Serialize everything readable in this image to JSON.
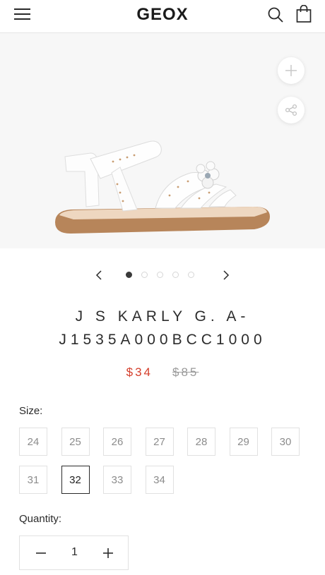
{
  "header": {
    "logo": "GEOX",
    "icons": [
      "hamburger-menu-icon",
      "search-icon",
      "shopping-bag-icon"
    ]
  },
  "gallery": {
    "image_alt": "White children's sandal with flower detail",
    "zoom_icon": "plus-icon",
    "share_icon": "share-icon",
    "slide_count": 5,
    "active_slide": 1
  },
  "product": {
    "title": "J S KARLY G. A-J1535A000BCC1000",
    "price_sale": "$34",
    "price_original": "$85"
  },
  "size": {
    "label": "Size:",
    "options": [
      "24",
      "25",
      "26",
      "27",
      "28",
      "29",
      "30",
      "31",
      "32",
      "33",
      "34"
    ],
    "selected": "32"
  },
  "quantity": {
    "label": "Quantity:",
    "value": "1"
  },
  "colors": {
    "sale": "#d43d2a",
    "text": "#1f1f1f",
    "muted": "#9a9a9a",
    "border": "#e1e1e1"
  }
}
